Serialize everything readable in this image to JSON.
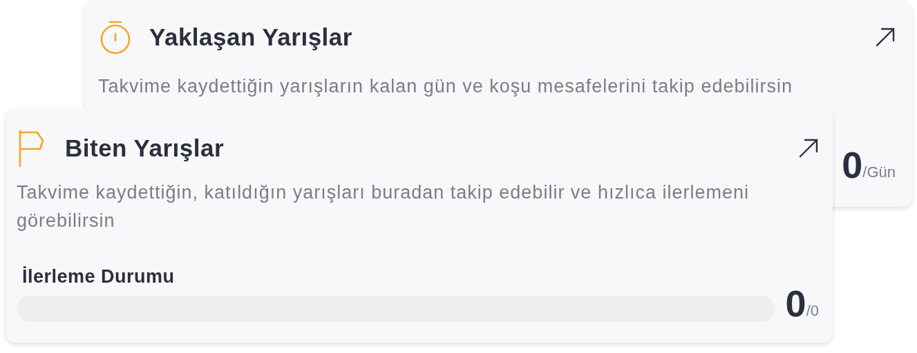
{
  "cards": [
    {
      "kind": "timer",
      "title": "Yaklaşan Yarışlar",
      "description": "Takvime kaydettiğin yarışların kalan gün ve koşu mesafelerini takip edebilirsin",
      "value": "0",
      "unit": "/Gün"
    },
    {
      "kind": "flag",
      "title": "Biten Yarışlar",
      "description": "Takvime kaydettiğin, katıldığın yarışları buradan takip edebilir ve hızlıca ilerlemeni görebilirsin",
      "progress_label": "İlerleme Durumu",
      "level": 0,
      "value": "0",
      "unit": "/0"
    }
  ]
}
